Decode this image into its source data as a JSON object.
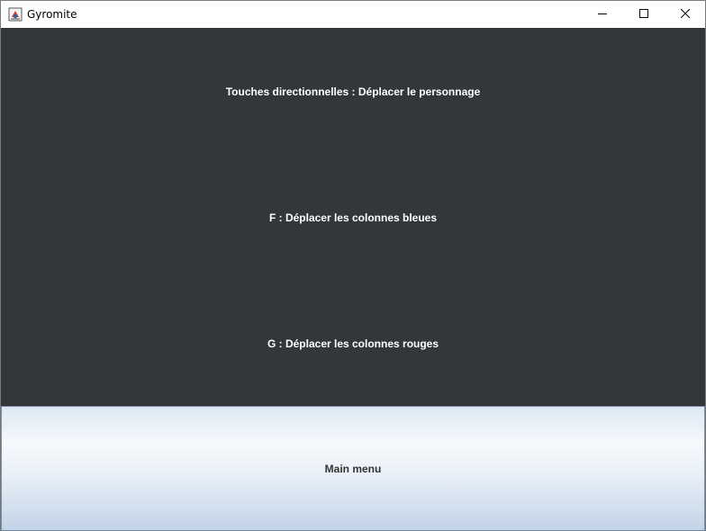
{
  "window": {
    "title": "Gyromite",
    "app_icon": "java-app-icon",
    "controls": {
      "minimize_icon": "minimize-icon",
      "maximize_icon": "maximize-icon",
      "close_icon": "close-icon"
    }
  },
  "instructions": [
    "Touches directionnelles : Déplacer le personnage",
    "F : Déplacer les colonnes bleues",
    "G : Déplacer les colonnes rouges"
  ],
  "main_menu_button": {
    "label": "Main menu"
  },
  "colors": {
    "content_background": "#33373b",
    "instruction_text": "#ffffff",
    "button_gradient_top": "#dde8f3",
    "button_gradient_bottom": "#c2d4e8",
    "button_text": "#333333"
  }
}
